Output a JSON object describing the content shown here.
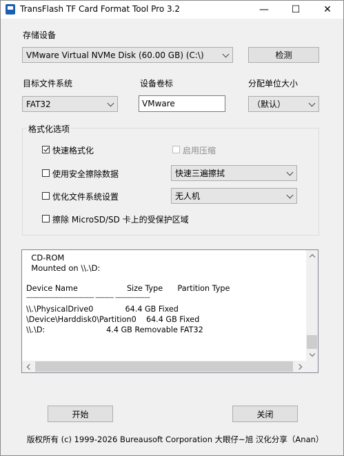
{
  "window": {
    "title": "TransFlash TF Card Format Tool Pro 3.2",
    "minimize_glyph": "—",
    "maximize_glyph": "☐",
    "close_glyph": "✕"
  },
  "device": {
    "label": "存储设备",
    "selected": "VMware Virtual NVMe Disk (60.00 GB) (C:\\)",
    "detect_button": "检测"
  },
  "filesystem": {
    "label": "目标文件系统",
    "selected": "FAT32"
  },
  "volume_label": {
    "label": "设备卷标",
    "value": "VMware"
  },
  "allocation": {
    "label": "分配单位大小",
    "selected": "（默认）"
  },
  "options": {
    "group_title": "格式化选项",
    "quick_format": {
      "label": "快速格式化",
      "checked": true
    },
    "enable_compression": {
      "label": "启用压缩",
      "checked": false,
      "enabled": false
    },
    "secure_erase": {
      "label": "使用安全擦除数据",
      "checked": false,
      "mode": "快速三遍擦拭"
    },
    "optimize_fs": {
      "label": "优化文件系统设置",
      "checked": false,
      "profile": "无人机"
    },
    "erase_protected": {
      "label": "擦除 MicroSD/SD 卡上的受保护区域",
      "checked": false
    }
  },
  "log": {
    "lines": [
      "  CD-ROM",
      "  Mounted on \\\\.\\D:",
      "",
      "Device Name                    Size Type      Partition Type",
      "------------------------------------- ---------- -------------------",
      "\\\\.\\PhysicalDrive0             64.4 GB Fixed",
      "\\Device\\Harddisk0\\Partition0    64.4 GB Fixed",
      "\\\\.\\D:                         4.4 GB Removable FAT32"
    ]
  },
  "actions": {
    "start": "开始",
    "close": "关闭"
  },
  "footer": {
    "copyright": "版权所有 (c) 1999-2026 Bureausoft Corporation 大眼仔~旭 汉化分享（Anan）"
  }
}
